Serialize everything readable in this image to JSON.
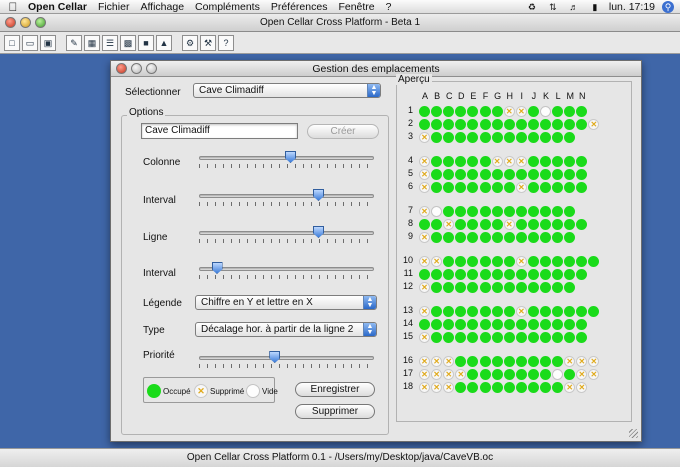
{
  "menubar": {
    "app_name": "Open Cellar",
    "items": [
      "Fichier",
      "Affichage",
      "Compléments",
      "Préférences",
      "Fenêtre",
      "?"
    ],
    "clock": "lun. 17:19"
  },
  "main_window": {
    "title": "Open Cellar Cross Platform - Beta 1",
    "status": "Open Cellar Cross Platform 0.1 - /Users/my/Desktop/java/CaveVB.oc"
  },
  "dialog": {
    "title": "Gestion des emplacements",
    "selector_label": "Sélectionner",
    "selector_value": "Cave Climadiff",
    "options_legend": "Options",
    "name_value": "Cave Climadiff",
    "create_label": "Créer",
    "colonne_label": "Colonne",
    "interval1_label": "Interval",
    "ligne_label": "Ligne",
    "interval2_label": "Interval",
    "legende_label": "Légende",
    "legende_value": "Chiffre en Y et lettre en X",
    "type_label": "Type",
    "type_value": "Décalage hor. à partir de la ligne 2",
    "priorite_label": "Priorité",
    "sliders": {
      "colonne": 0.52,
      "interval1": 0.68,
      "ligne": 0.68,
      "interval2": 0.1,
      "priorite": 0.43
    },
    "legend": {
      "occupied": "Occupé",
      "deleted": "Supprimé",
      "empty": "Vide"
    },
    "save_label": "Enregistrer",
    "delete_label": "Supprimer",
    "apercu_legend": "Aperçu",
    "columns": [
      "A",
      "B",
      "C",
      "D",
      "E",
      "F",
      "G",
      "H",
      "I",
      "J",
      "K",
      "L",
      "M",
      "N"
    ],
    "groups": [
      {
        "rows": [
          {
            "label": "1",
            "offset": 0,
            "cells": "ooooooossovooo"
          },
          {
            "label": "2",
            "offset": 0,
            "cells": "oooooooooooooos"
          },
          {
            "label": "3",
            "offset": 0,
            "cells": "soooooooooooo"
          }
        ]
      },
      {
        "rows": [
          {
            "label": "4",
            "offset": 0,
            "cells": "sooooosssooooo"
          },
          {
            "label": "5",
            "offset": 0,
            "cells": "sooooooooooooo"
          },
          {
            "label": "6",
            "offset": 0,
            "cells": "sooooooosooooo"
          }
        ]
      },
      {
        "rows": [
          {
            "label": "7",
            "offset": 0,
            "cells": "svooooooooooo"
          },
          {
            "label": "8",
            "offset": 0,
            "cells": "oosoooosoooooo"
          },
          {
            "label": "9",
            "offset": 0,
            "cells": "soooooooooooo"
          }
        ]
      },
      {
        "rows": [
          {
            "label": "10",
            "offset": 0,
            "cells": "ssoooooosoooooo"
          },
          {
            "label": "11",
            "offset": 0,
            "cells": "oooooooooooooo"
          },
          {
            "label": "12",
            "offset": 0,
            "cells": "soooooooooooo"
          }
        ]
      },
      {
        "rows": [
          {
            "label": "13",
            "offset": 0,
            "cells": "sooooooosoooooo"
          },
          {
            "label": "14",
            "offset": 0,
            "cells": "oooooooooooooo"
          },
          {
            "label": "15",
            "offset": 0,
            "cells": "sooooooooooooo"
          }
        ]
      },
      {
        "rows": [
          {
            "label": "16",
            "offset": 0,
            "cells": "sssooooooooosss"
          },
          {
            "label": "17",
            "offset": 0,
            "cells": "ssssooooooovoss"
          },
          {
            "label": "18",
            "offset": 0,
            "cells": "sssoooooooooss"
          }
        ]
      }
    ]
  },
  "colors": {
    "occupied": "#1adb1a",
    "deleted_mark": "#e0aa1c",
    "desktop": "#3f66a8"
  }
}
